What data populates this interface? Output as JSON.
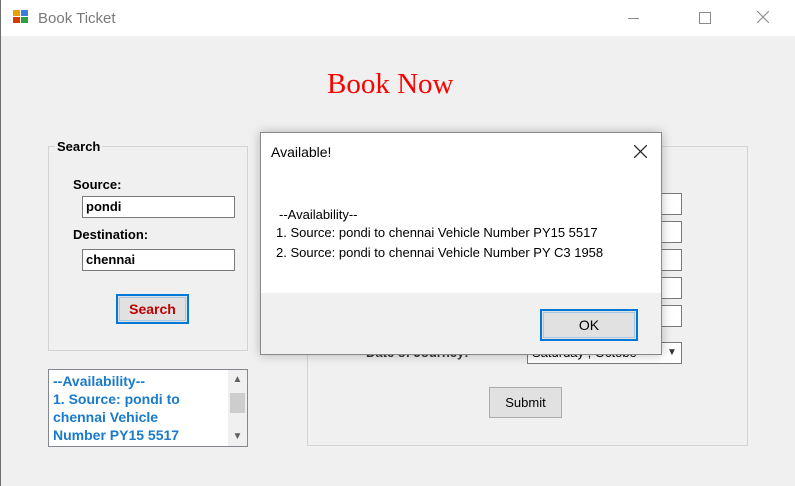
{
  "window": {
    "title": "Book Ticket",
    "icon": "app-icon"
  },
  "main": {
    "heading": "Book Now",
    "heading_color": "#ff0000"
  },
  "search": {
    "group_title": "Search",
    "source_label": "Source:",
    "source_value": "pondi",
    "destination_label": "Destination:",
    "destination_value": "chennai",
    "search_button": "Search",
    "search_button_color": "#c00000"
  },
  "availability_list": {
    "lines": [
      "--Availability--",
      "1. Source: pondi to",
      "chennai Vehicle",
      "Number PY15 5517"
    ],
    "text_color": "#1a7acb"
  },
  "booking": {
    "date_label": "Date of Journey:",
    "date_value": "Saturday ,  Octobe",
    "submit_button": "Submit"
  },
  "dialog": {
    "title": "Available!",
    "header_line": "--Availability--",
    "lines": [
      "1. Source: pondi to chennai Vehicle Number PY15 5517",
      "2. Source: pondi to chennai Vehicle Number PY C3 1958"
    ],
    "ok_button": "OK",
    "accent_color": "#0078d7"
  }
}
